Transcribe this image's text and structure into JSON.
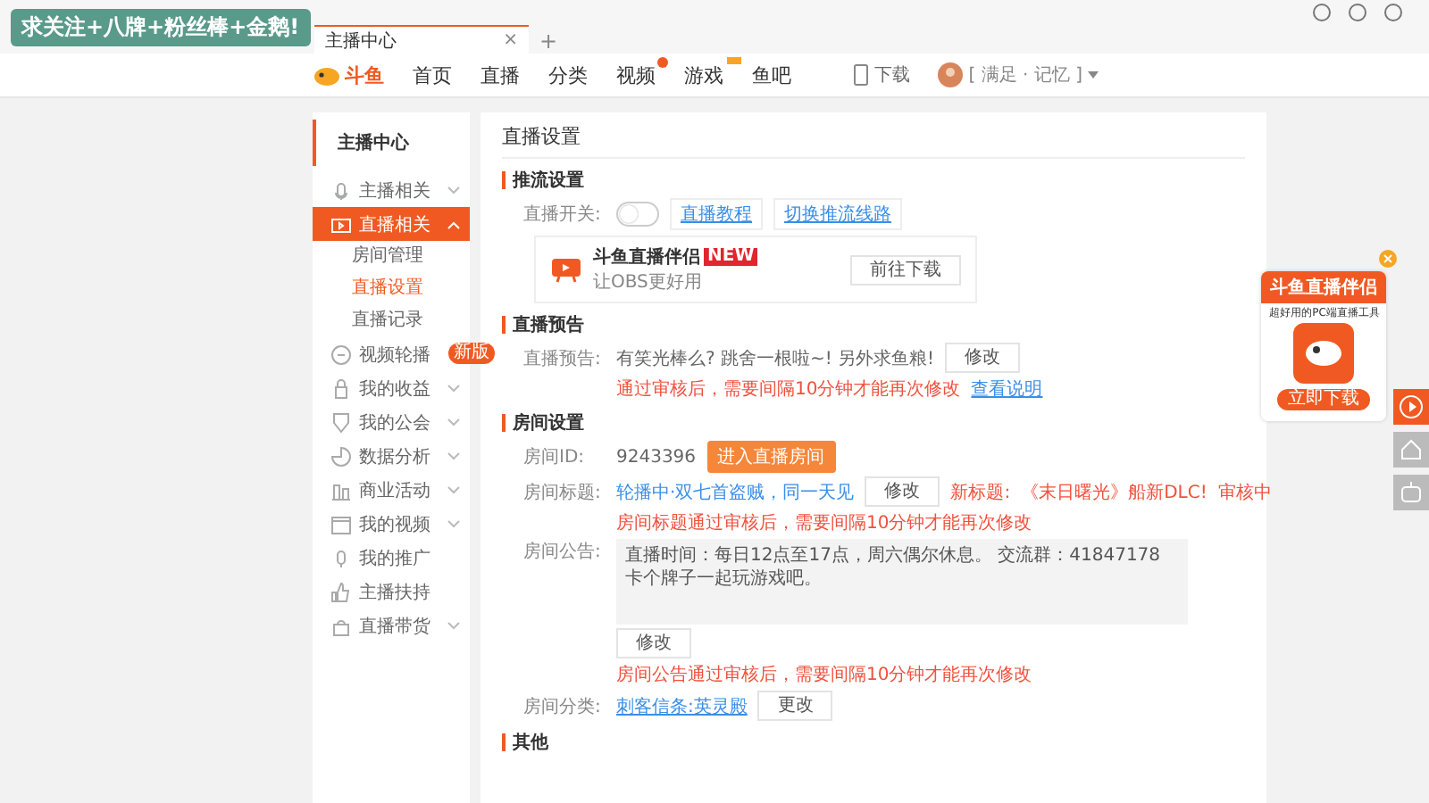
{
  "overlay_caption": "求关注+八牌+粉丝棒+金鹅!",
  "browser": {
    "tabs": [
      {
        "label": "主播中心",
        "selected": true
      }
    ],
    "tab_close": "×",
    "new_tab": "+"
  },
  "nav": {
    "logo": "斗鱼",
    "items": [
      {
        "label": "首页",
        "kind": "plain"
      },
      {
        "label": "直播",
        "kind": "plain"
      },
      {
        "label": "分类",
        "kind": "plain"
      },
      {
        "label": "视频",
        "kind": "dot"
      },
      {
        "label": "游戏",
        "kind": "tag"
      },
      {
        "label": "鱼吧",
        "kind": "plain"
      }
    ],
    "download": "下载",
    "user": "[ 满足 · 记忆 ]"
  },
  "sidebar": {
    "title": "主播中心",
    "items": [
      {
        "label": "主播相关",
        "expandable": true,
        "expanded": false,
        "selected": false
      },
      {
        "label": "直播相关",
        "expandable": true,
        "expanded": true,
        "selected": true,
        "children": [
          {
            "label": "房间管理",
            "selected": false
          },
          {
            "label": "直播设置",
            "selected": true
          },
          {
            "label": "直播记录",
            "selected": false
          }
        ]
      },
      {
        "label": "视频轮播",
        "expandable": false,
        "selected": false,
        "badge": "新版"
      },
      {
        "label": "我的收益",
        "expandable": true,
        "expanded": false,
        "selected": false
      },
      {
        "label": "我的公会",
        "expandable": true,
        "expanded": false,
        "selected": false
      },
      {
        "label": "数据分析",
        "expandable": true,
        "expanded": false,
        "selected": false
      },
      {
        "label": "商业活动",
        "expandable": true,
        "expanded": false,
        "selected": false
      },
      {
        "label": "我的视频",
        "expandable": true,
        "expanded": false,
        "selected": false
      },
      {
        "label": "我的推广",
        "expandable": false,
        "selected": false
      },
      {
        "label": "主播扶持",
        "expandable": false,
        "selected": false
      },
      {
        "label": "直播带货",
        "expandable": true,
        "expanded": false,
        "selected": false
      }
    ]
  },
  "page_title": "直播设置",
  "stream": {
    "heading": "推流设置",
    "switch_label": "直播开关:",
    "switch_on": false,
    "links": [
      "直播教程",
      "切换推流线路"
    ],
    "promo": {
      "name": "斗鱼直播伴侣",
      "badge": "NEW",
      "subtitle": "让OBS更好用",
      "button": "前往下载"
    }
  },
  "preview": {
    "heading": "直播预告",
    "label": "直播预告:",
    "text": "有笑光棒么? 跳舍一根啦~! 另外求鱼粮!",
    "button": "修改",
    "notice": "通过审核后，需要间隔10分钟才能再次修改",
    "link": "查看说明"
  },
  "room": {
    "heading": "房间设置",
    "id_label": "房间ID:",
    "id": "9243396",
    "enter_button": "进入直播房间",
    "title_label": "房间标题:",
    "title": "轮播中·双七首盗贼，同一天见",
    "title_button": "修改",
    "new_title_label": "新标题:",
    "new_title": "《末日曙光》船新DLC!",
    "review_status": "审核中",
    "title_notice": "房间标题通过审核后，需要间隔10分钟才能再次修改",
    "announce_label": "房间公告:",
    "announcement": "直播时间：每日12点至17点，周六偶尔休息。 交流群：41847178 卡个牌子一起玩游戏吧。",
    "announce_button": "修改",
    "announce_notice": "房间公告通过审核后，需要间隔10分钟才能再次修改",
    "category_label": "房间分类:",
    "category": "刺客信条:英灵殿",
    "category_button": "更改"
  },
  "other": {
    "heading": "其他"
  },
  "ad": {
    "title": "斗鱼直播伴侣",
    "subtitle": "超好用的PC端直播工具",
    "button": "立即下载"
  }
}
